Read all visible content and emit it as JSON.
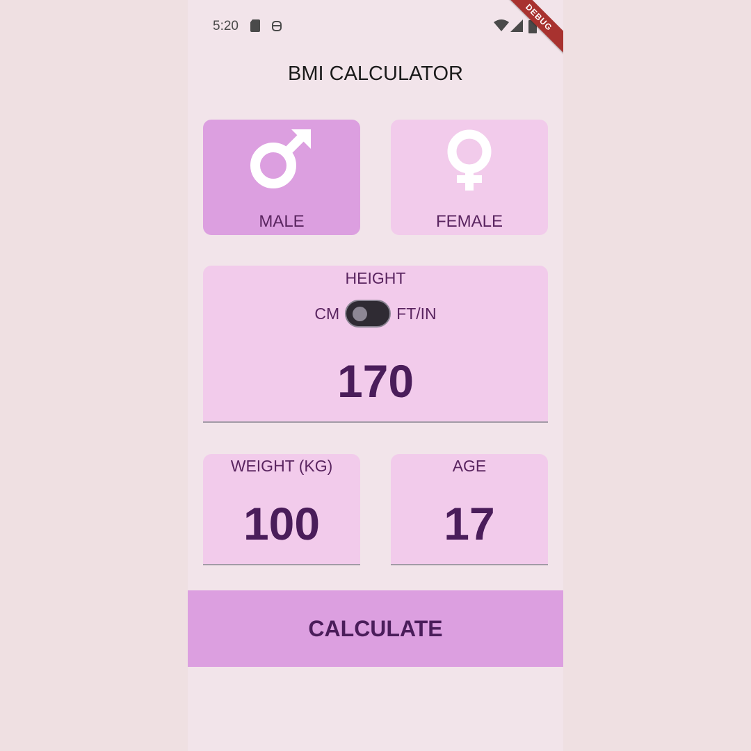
{
  "status_bar": {
    "time": "5:20",
    "icons": [
      "sd-card-icon",
      "android-icon",
      "wifi-icon",
      "cell-signal-icon",
      "battery-icon"
    ],
    "debug_banner": "DEBUG"
  },
  "app": {
    "title": "BMI CALCULATOR"
  },
  "gender": {
    "male_label": "MALE",
    "female_label": "FEMALE",
    "selected": "male"
  },
  "height": {
    "title": "HEIGHT",
    "unit_left": "CM",
    "unit_right": "FT/IN",
    "toggle_on": false,
    "value": "170"
  },
  "weight": {
    "title": "WEIGHT (KG)",
    "value": "100"
  },
  "age": {
    "title": "AGE",
    "value": "17"
  },
  "actions": {
    "calculate_label": "CALCULATE"
  },
  "colors": {
    "background": "#f2e4ea",
    "card": "#f2cbeb",
    "card_selected": "#dc9fe0",
    "text": "#5a2560",
    "value_text": "#4a1d5a",
    "debug_ribbon": "#a8322f"
  }
}
